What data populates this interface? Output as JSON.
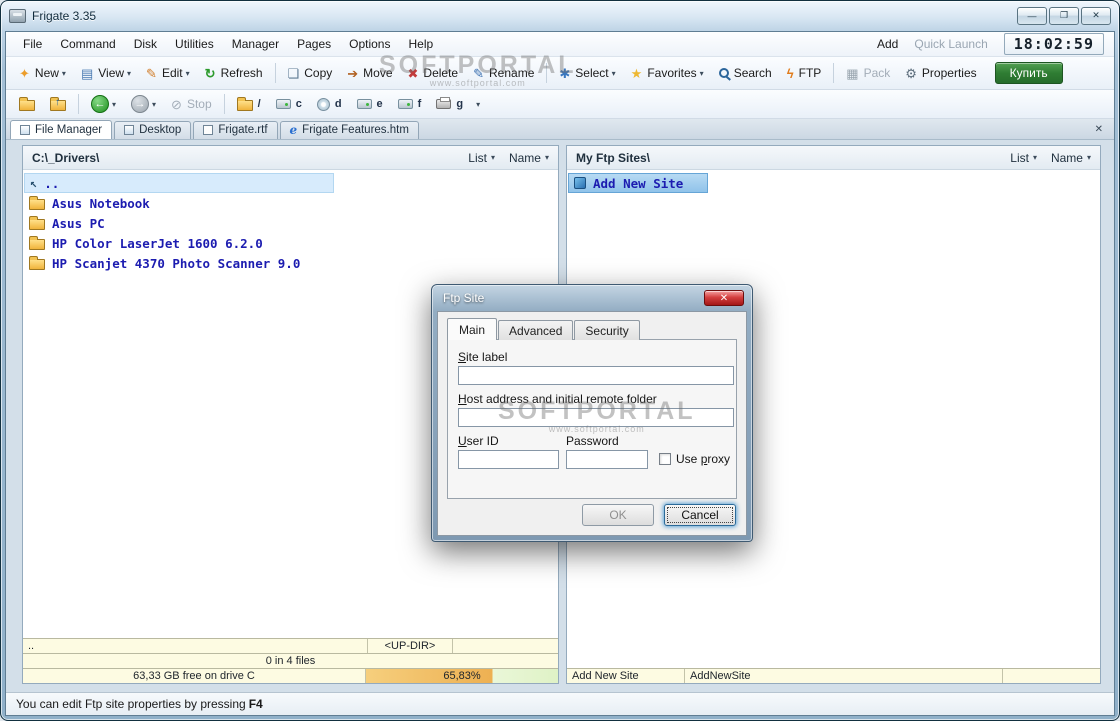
{
  "window": {
    "title": "Frigate 3.35"
  },
  "icons": {
    "minimize": "—",
    "maximize": "❐",
    "close": "✕",
    "dropdown": "▾",
    "new": "✦",
    "view": "▤",
    "edit": "✎",
    "refresh": "↻",
    "copy": "❏",
    "move": "➔",
    "delete": "✖",
    "rename": "✎",
    "select": "✱",
    "favorites": "★",
    "ftp": "ϟ",
    "pack": "▦",
    "properties": "⚙",
    "back": "←",
    "forward": "→",
    "stop": "⊘",
    "up_arrow": "↖",
    "tab_close": "✕",
    "dialog_close": "✕"
  },
  "menubar": {
    "items": [
      "File",
      "Command",
      "Disk",
      "Utilities",
      "Manager",
      "Pages",
      "Options",
      "Help"
    ],
    "add": "Add",
    "quick_launch": "Quick Launch",
    "clock": "18:02:59"
  },
  "toolbar": {
    "new": "New",
    "view": "View",
    "edit": "Edit",
    "refresh": "Refresh",
    "copy": "Copy",
    "move": "Move",
    "delete": "Delete",
    "rename": "Rename",
    "select": "Select",
    "favorites": "Favorites",
    "search": "Search",
    "ftp": "FTP",
    "pack": "Pack",
    "properties": "Properties",
    "buy": "Купить"
  },
  "navbar": {
    "stop": "Stop",
    "root": "/",
    "drives": [
      "c",
      "d",
      "e",
      "f",
      "g"
    ]
  },
  "tabs": {
    "items": [
      "File Manager",
      "Desktop",
      "Frigate.rtf",
      "Frigate Features.htm"
    ]
  },
  "left_panel": {
    "path": "C:\\_Drivers\\",
    "list_label": "List",
    "name_label": "Name",
    "up_item": "..",
    "files": [
      "Asus Notebook",
      "Asus PC",
      "HP Color LaserJet 1600 6.2.0",
      "HP Scanjet 4370 Photo Scanner 9.0"
    ],
    "footer": {
      "current": "..",
      "updir": "<UP-DIR>",
      "count": "0 in 4 files",
      "free": "63,33 GB free on drive C",
      "usage": "65,83%",
      "usage_pct": 65.83
    }
  },
  "right_panel": {
    "path": "My Ftp Sites\\",
    "list_label": "List",
    "name_label": "Name",
    "selected_item": "Add New Site",
    "footer": {
      "name": "Add New Site",
      "value": "AddNewSite"
    }
  },
  "dialog": {
    "title": "Ftp Site",
    "tabs": [
      "Main",
      "Advanced",
      "Security"
    ],
    "labels": {
      "site": {
        "key": "S",
        "rest": "ite label"
      },
      "host": {
        "key": "H",
        "rest": "ost address and initial remote folder"
      },
      "user": {
        "key": "U",
        "rest": "ser ID"
      },
      "password": "Password",
      "proxy": {
        "pre": "Use ",
        "key": "p",
        "rest": "roxy"
      }
    },
    "buttons": {
      "ok": "OK",
      "cancel": "Cancel"
    }
  },
  "statusbar": {
    "text": "You can edit Ftp site properties by pressing ",
    "key": "F4"
  },
  "watermark": {
    "text": "SOFTPORTAL",
    "url": "www.softportal.com"
  }
}
